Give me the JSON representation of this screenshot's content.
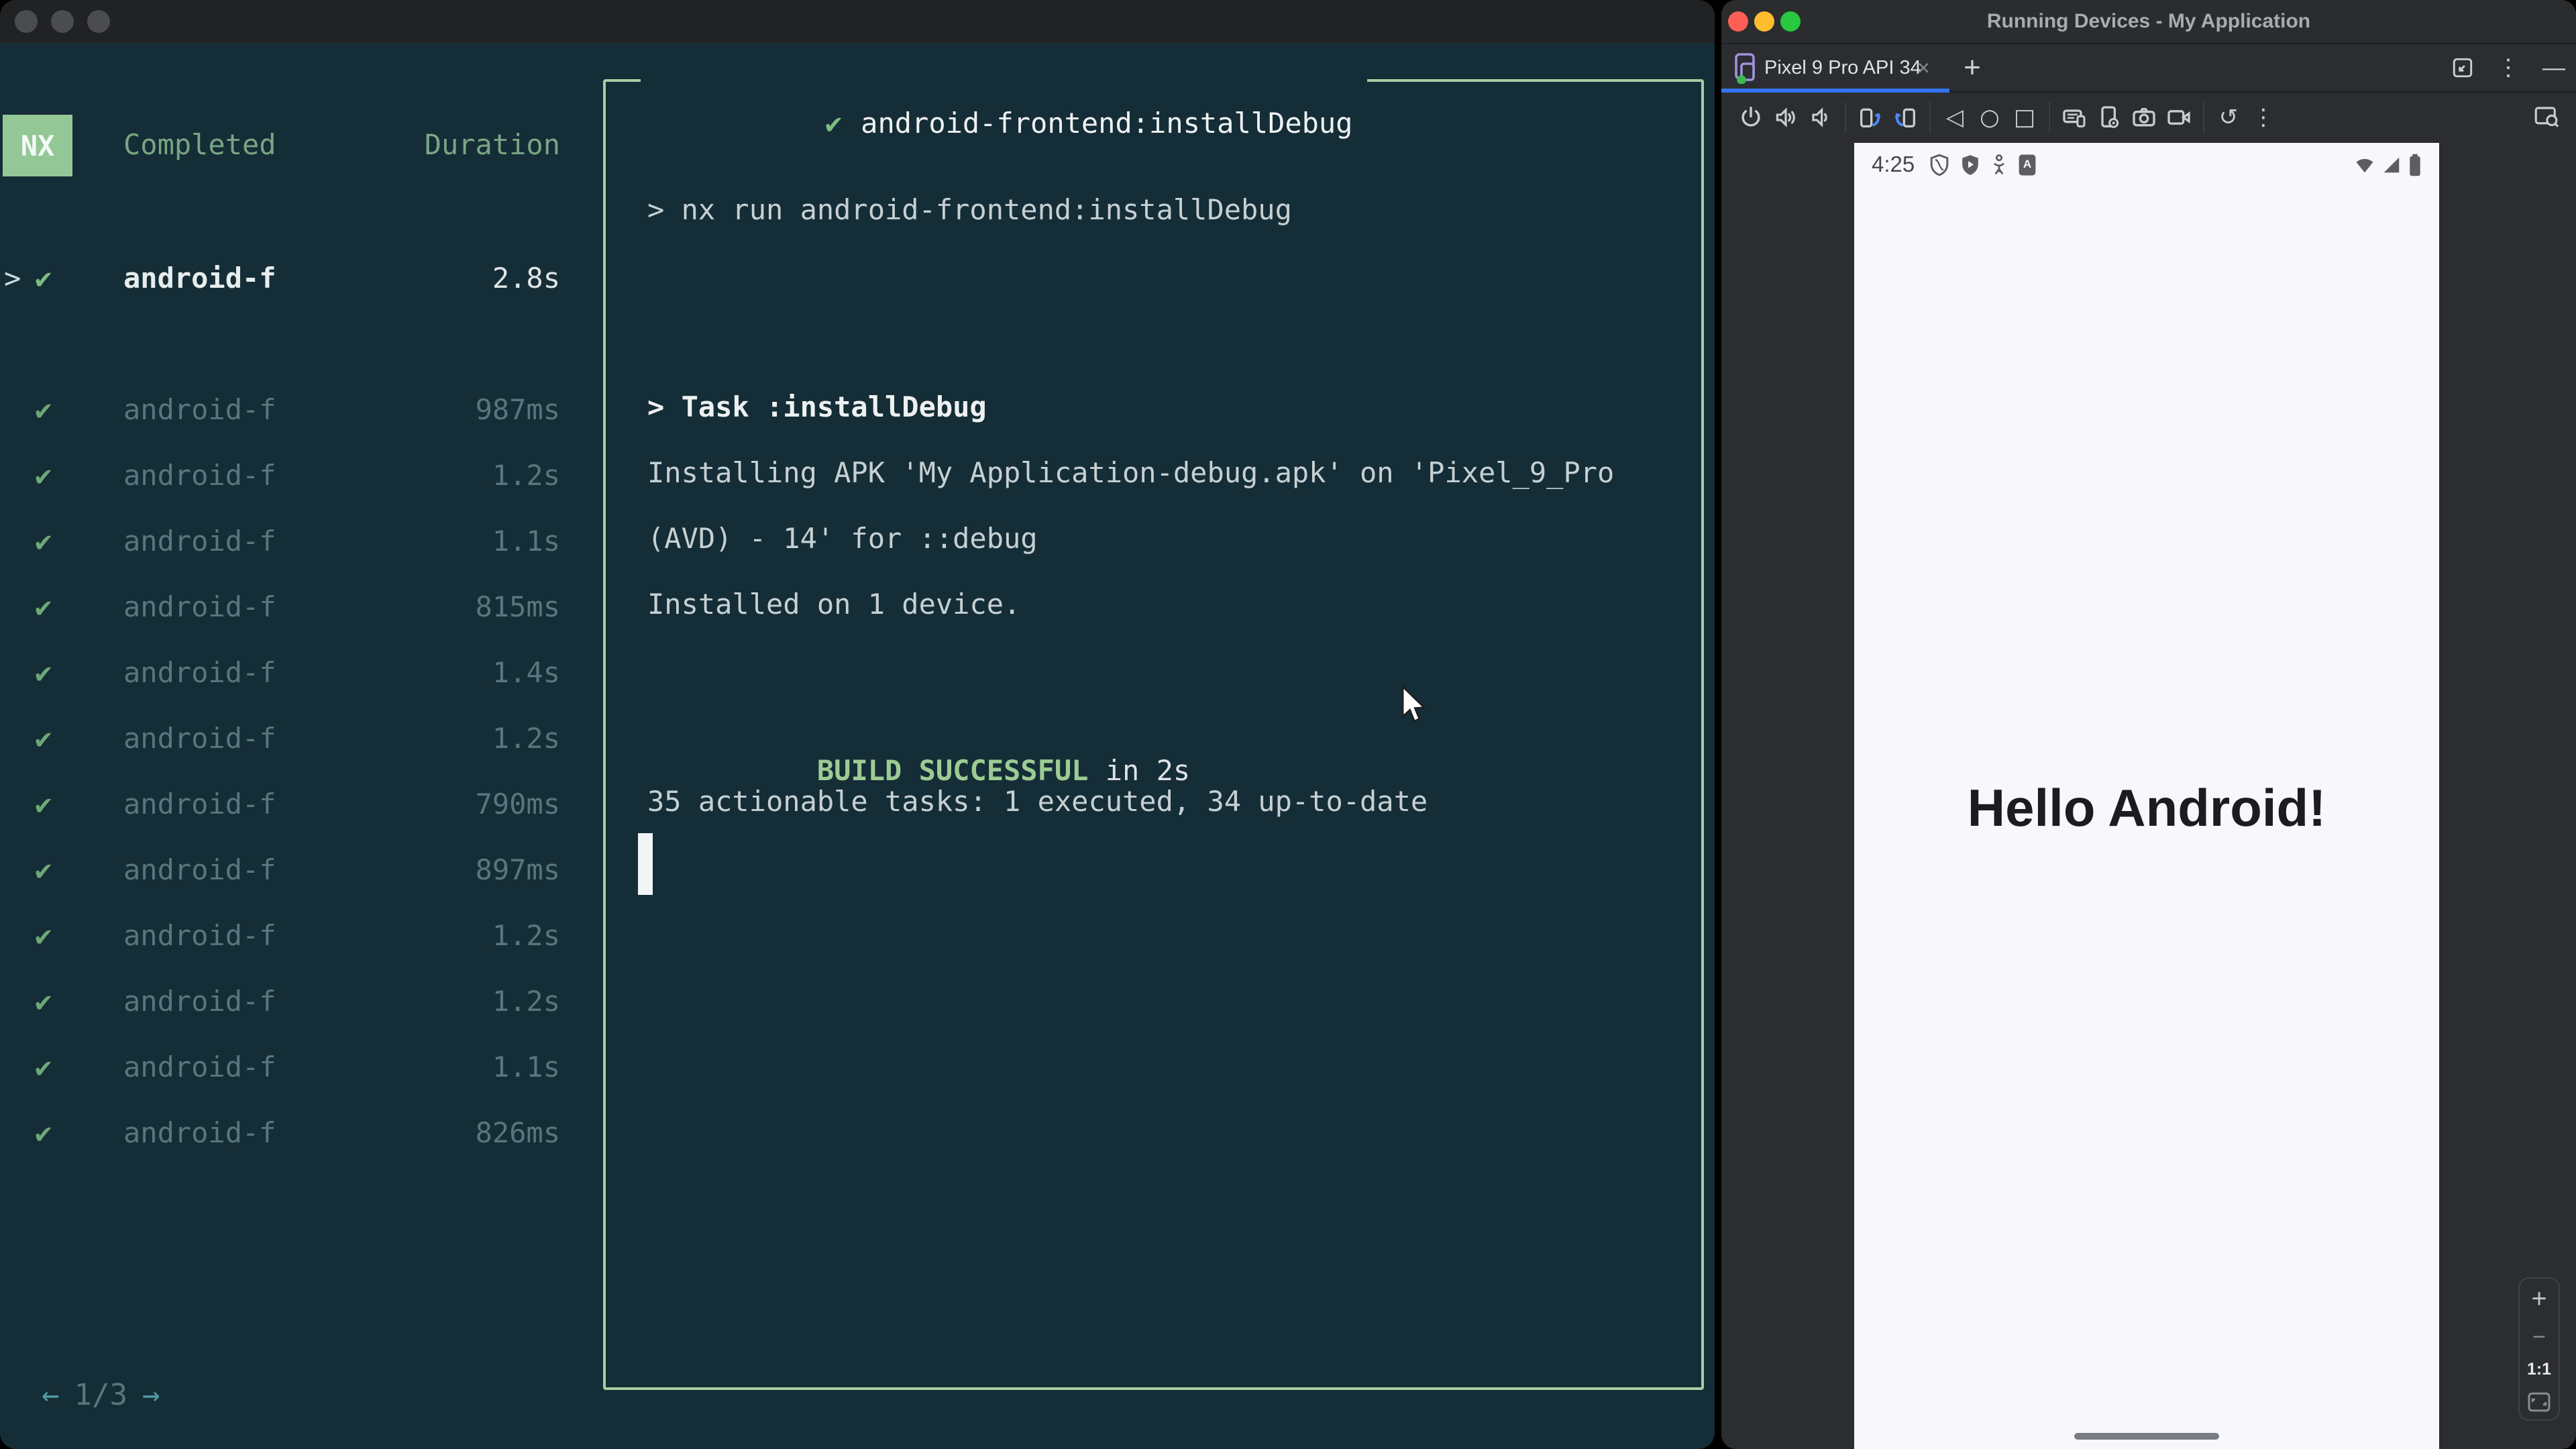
{
  "colors": {
    "terminal_bg": "#152d36",
    "box_border_green": "#a9cda4",
    "badge_green": "#93c795",
    "check_green": "#7cbd83",
    "dim_text": "#5a757e",
    "bright_text": "#e7eced",
    "success_green": "#9ccb93",
    "pager_teal": "#4f9ba0",
    "tab_underline_blue": "#3574f0",
    "panel_bg": "#2b2d30",
    "screen_bg": "#f7f7fc",
    "hello_text": "#1b1b22",
    "traffic_red": "#ff5f57",
    "traffic_yellow": "#febc2e",
    "traffic_green": "#28c840"
  },
  "left_window": {
    "sidebar": {
      "logo": "NX",
      "col_completed": "Completed",
      "col_duration": "Duration",
      "selected_task": {
        "caret": ">",
        "check": "✔",
        "name": "android-f",
        "duration": "2.8s"
      },
      "tasks": [
        {
          "check": "✔",
          "name": "android-f",
          "duration": "987ms"
        },
        {
          "check": "✔",
          "name": "android-f",
          "duration": "1.2s"
        },
        {
          "check": "✔",
          "name": "android-f",
          "duration": "1.1s"
        },
        {
          "check": "✔",
          "name": "android-f",
          "duration": "815ms"
        },
        {
          "check": "✔",
          "name": "android-f",
          "duration": "1.4s"
        },
        {
          "check": "✔",
          "name": "android-f",
          "duration": "1.2s"
        },
        {
          "check": "✔",
          "name": "android-f",
          "duration": "790ms"
        },
        {
          "check": "✔",
          "name": "android-f",
          "duration": "897ms"
        },
        {
          "check": "✔",
          "name": "android-f",
          "duration": "1.2s"
        },
        {
          "check": "✔",
          "name": "android-f",
          "duration": "1.2s"
        },
        {
          "check": "✔",
          "name": "android-f",
          "duration": "1.1s"
        },
        {
          "check": "✔",
          "name": "android-f",
          "duration": "826ms"
        }
      ],
      "pagination": {
        "prev": "←",
        "current": "1/3",
        "next": "→"
      }
    },
    "output": {
      "check": "✔",
      "title": "android-frontend:installDebug",
      "command": "> nx run android-frontend:installDebug",
      "task_line": "> Task :installDebug",
      "install_line_1": "Installing APK 'My Application-debug.apk' on 'Pixel_9_Pro",
      "install_line_2": "(AVD) - 14' for ::debug",
      "install_line_3": "Installed on 1 device.",
      "build_status": "BUILD SUCCESSFUL",
      "build_time": " in 2s",
      "summary": "35 actionable tasks: 1 executed, 34 up-to-date"
    }
  },
  "right_window": {
    "title": "Running Devices - My Application",
    "tab": {
      "label": "Pixel 9 Pro API 34",
      "close": "×",
      "new_tab": "+"
    },
    "tab_actions": {
      "more": "⋮",
      "hide": "—"
    },
    "toolbar_glyphs": {
      "back": "◁",
      "home": "○",
      "overview": "□",
      "restart": "↺",
      "more": "⋮"
    },
    "emulator": {
      "status_time": "4:25",
      "app_text": "Hello Android!",
      "zoom_controls": {
        "zoom_in": "+",
        "zoom_out": "−",
        "actual_size": "1:1"
      }
    }
  }
}
